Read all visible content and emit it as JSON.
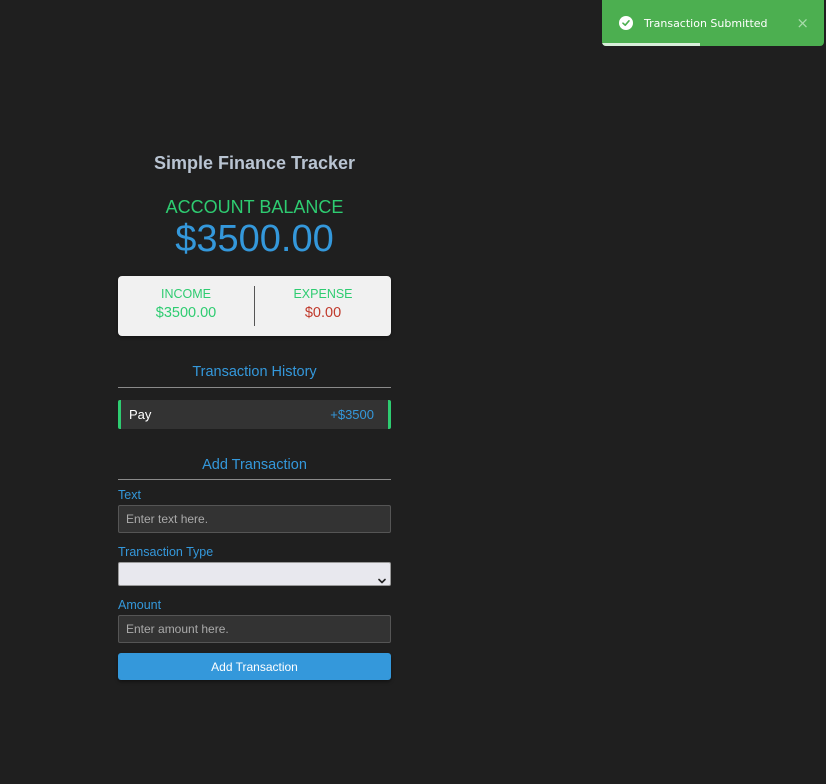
{
  "toast": {
    "icon": "check-circle-icon",
    "message": "Transaction Submitted",
    "close_glyph": "×",
    "progress_fraction": 0.44,
    "color": "#4caf50"
  },
  "header": {
    "title": "Simple Finance Tracker"
  },
  "balance": {
    "label": "ACCOUNT BALANCE",
    "value": "$3500.00"
  },
  "summary": {
    "income_label": "INCOME",
    "income_value": "$3500.00",
    "expense_label": "EXPENSE",
    "expense_value": "$0.00"
  },
  "history": {
    "title": "Transaction History",
    "items": [
      {
        "text": "Pay",
        "amount": "+$3500"
      }
    ]
  },
  "form": {
    "title": "Add Transaction",
    "text_label": "Text",
    "text_placeholder": "Enter text here.",
    "type_label": "Transaction Type",
    "type_value": "",
    "amount_label": "Amount",
    "amount_placeholder": "Enter amount here.",
    "submit_label": "Add Transaction"
  },
  "colors": {
    "background": "#1f1f1f",
    "accent_blue": "#3498db",
    "income_green": "#2ecc71",
    "expense_red": "#c0392b"
  }
}
